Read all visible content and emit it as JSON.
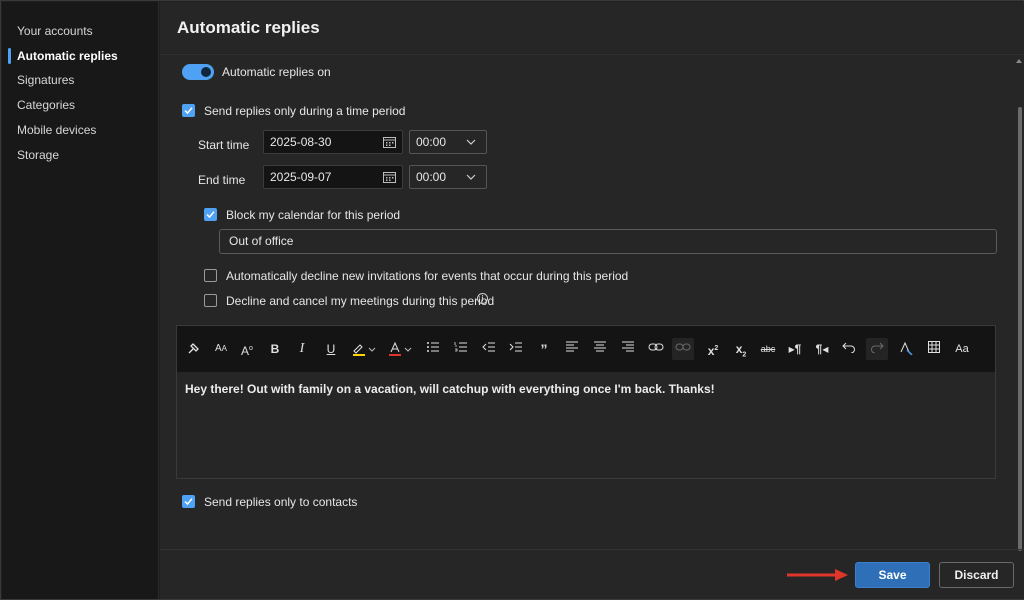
{
  "sidebar": {
    "items": [
      {
        "label": "Your accounts"
      },
      {
        "label": "Automatic replies"
      },
      {
        "label": "Signatures"
      },
      {
        "label": "Categories"
      },
      {
        "label": "Mobile devices"
      },
      {
        "label": "Storage"
      }
    ],
    "active_index": 1
  },
  "page": {
    "title": "Automatic replies"
  },
  "settings": {
    "auto_replies_label": "Automatic replies on",
    "auto_replies_on": true,
    "time_period_label": "Send replies only during a time period",
    "time_period_checked": true,
    "start_label": "Start time",
    "start_date": "2025-08-30",
    "start_time": "00:00",
    "end_label": "End time",
    "end_date": "2025-09-07",
    "end_time": "00:00",
    "block_calendar_label": "Block my calendar for this period",
    "block_calendar_checked": true,
    "event_title_value": "Out of office",
    "decline_invitations_label": "Automatically decline new invitations for events that occur during this period",
    "decline_invitations_checked": false,
    "decline_meetings_label": "Decline and cancel my meetings during this period",
    "decline_meetings_checked": false,
    "contacts_only_label": "Send replies only to contacts",
    "contacts_only_checked": true
  },
  "editor": {
    "message": "Hey there! Out with family on a vacation, will catchup with everything once I'm back. Thanks!",
    "toolbar_icons": [
      "format-painter-icon",
      "font-size-decrease-icon",
      "font-size-increase-icon",
      "bold-icon",
      "italic-icon",
      "underline-icon",
      "highlight-icon",
      "font-color-icon",
      "bullets-icon",
      "numbering-icon",
      "decrease-indent-icon",
      "increase-indent-icon",
      "quote-icon",
      "align-left-icon",
      "align-center-icon",
      "align-right-icon",
      "link-icon",
      "unlink-icon",
      "superscript-icon",
      "subscript-icon",
      "strikethrough-icon",
      "ltr-icon",
      "rtl-icon",
      "undo-icon",
      "redo-icon",
      "clear-format-icon",
      "table-icon",
      "change-case-icon"
    ]
  },
  "footer": {
    "save_label": "Save",
    "discard_label": "Discard"
  },
  "colors": {
    "accent": "#4ea1f3",
    "save_button": "#2f6fb8",
    "annotation_arrow": "#e0352b",
    "background": "#262626",
    "sidebar_background": "#181818"
  }
}
